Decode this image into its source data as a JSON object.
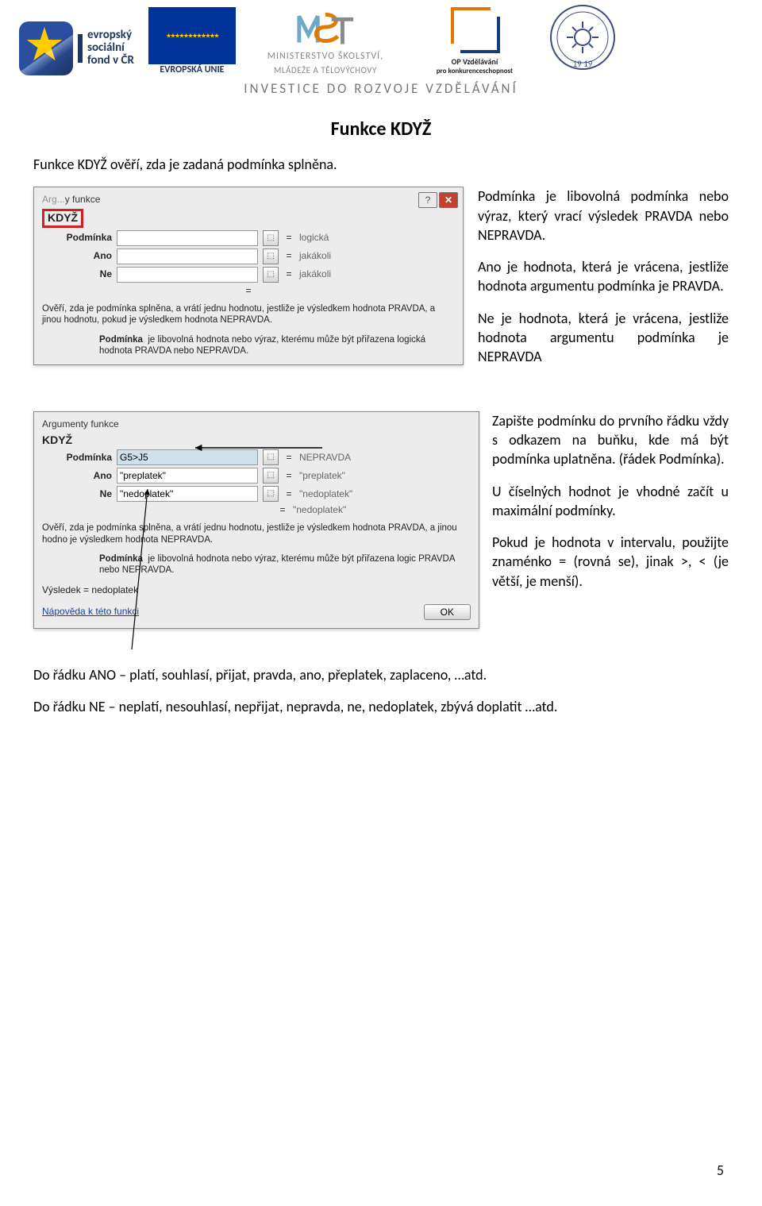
{
  "header": {
    "esf_lines": "evropský\nsociální\nfond v ČR",
    "eu_caption": "EVROPSKÁ UNIE",
    "msmt_line1": "MINISTERSTVO ŠKOLSTVÍ,",
    "msmt_line2": "MLÁDEŽE A TĚLOVÝCHOVY",
    "opvk_line1": "OP Vzdělávání",
    "opvk_line2": "pro konkurenceschopnost",
    "crest_year": "19 19",
    "tagline": "INVESTICE DO ROZVOJE VZDĚLÁVÁNÍ"
  },
  "title": "Funkce KDYŽ",
  "intro": "Funkce KDYŽ ověří, zda je zadaná podmínka splněna.",
  "side1_p1": "Podmínka je libovolná podmínka nebo výraz, který vrací výsledek PRAVDA nebo NEPRAVDA.",
  "side1_p2": "Ano je hodnota, která je vrácena, jestliže hodnota argumentu podmínka je PRAVDA.",
  "side1_p3": "Ne je hodnota, která je vrácena, jestliže hodnota argumentu podmínka je NEPRAVDA",
  "side2_p1": "Zapište podmínku do prvního řádku vždy s odkazem na buňku, kde má být podmínka uplatněna. (řádek Podmínka).",
  "side2_p2": "U číselných hodnot je vhodné začít u maximální podmínky.",
  "side2_p3": "Pokud je hodnota v intervalu, použijte znaménko = (rovná se), jinak >, < (je větší, je menší).",
  "foot1": "Do řádku ANO – platí, souhlasí, přijat, pravda, ano, přeplatek, zaplaceno, …atd.",
  "foot2": "Do řádku NE – neplatí, nesouhlasí, nepřijat, nepravda, ne, nedoplatek, zbývá doplatit …atd.",
  "page_number": "5",
  "dlg1": {
    "section": "y funkce",
    "fn": "KDYŽ",
    "rows": {
      "podminka": {
        "label": "Podmínka",
        "value": "",
        "right": "logická"
      },
      "ano": {
        "label": "Ano",
        "value": "",
        "right": "jakákoli"
      },
      "ne": {
        "label": "Ne",
        "value": "",
        "right": "jakákoli"
      }
    },
    "eq_only": "=",
    "desc_main": "Ověří, zda je podmínka splněna, a vrátí jednu hodnotu, jestliže je výsledkem hodnota PRAVDA, a jinou hodnotu, pokud je výsledkem hodnota NEPRAVDA.",
    "desc_sub_label": "Podmínka",
    "desc_sub_text": "je libovolná hodnota nebo výraz, kterému může být přiřazena logická hodnota PRAVDA nebo NEPRAVDA.",
    "help_glyph": "?",
    "close_glyph": "✕"
  },
  "dlg2": {
    "section": "Argumenty funkce",
    "fn": "KDYŽ",
    "rows": {
      "podminka": {
        "label": "Podmínka",
        "value": "G5>J5",
        "right": "NEPRAVDA"
      },
      "ano": {
        "label": "Ano",
        "value": "\"preplatek\"",
        "right": "\"preplatek\""
      },
      "ne": {
        "label": "Ne",
        "value": "\"nedoplatek\"",
        "right": "\"nedoplatek\""
      }
    },
    "eq_right": "\"nedoplatek\"",
    "desc_main": "Ověří, zda je podmínka splněna, a vrátí jednu hodnotu, jestliže je výsledkem hodnota PRAVDA, a jinou hodno je výsledkem hodnota NEPRAVDA.",
    "desc_sub_label": "Podmínka",
    "desc_sub_text": "je libovolná hodnota nebo výraz, kterému může být přiřazena logic PRAVDA nebo NEPRAVDA.",
    "result_label": "Výsledek =",
    "result_value": "nedoplatek",
    "help_link": "Nápověda k této funkci",
    "ok": "OK"
  }
}
